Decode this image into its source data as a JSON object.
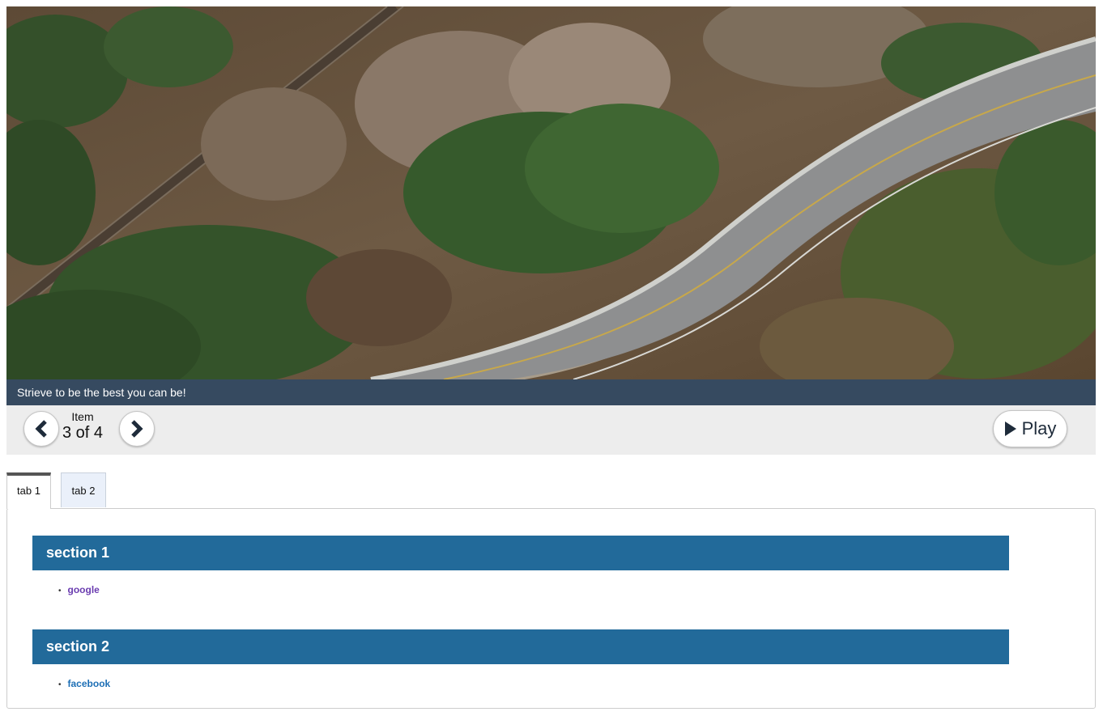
{
  "carousel": {
    "image_alt": "Aerial view of a curving road through forest",
    "caption": "Strieve to be the best you can be!",
    "counter_label": "Item",
    "counter_value": "3 of 4",
    "prev_icon": "chevron-left-icon",
    "next_icon": "chevron-right-icon",
    "play_icon": "play-icon",
    "play_label": "Play"
  },
  "tabs": [
    {
      "label": "tab 1",
      "active": true
    },
    {
      "label": "tab 2",
      "active": false
    }
  ],
  "sections": [
    {
      "title": "section 1",
      "links": [
        "google"
      ]
    },
    {
      "title": "section 2",
      "links": [
        "facebook"
      ]
    }
  ],
  "colors": {
    "caption_bg": "#364a60",
    "controls_bg": "#ededed",
    "section_bg": "#226a9a",
    "visited_link": "#6a3cb0",
    "link": "#1d6fb5",
    "tab_active_border": "#555555",
    "tab_inactive_bg": "#eaf0fa"
  }
}
